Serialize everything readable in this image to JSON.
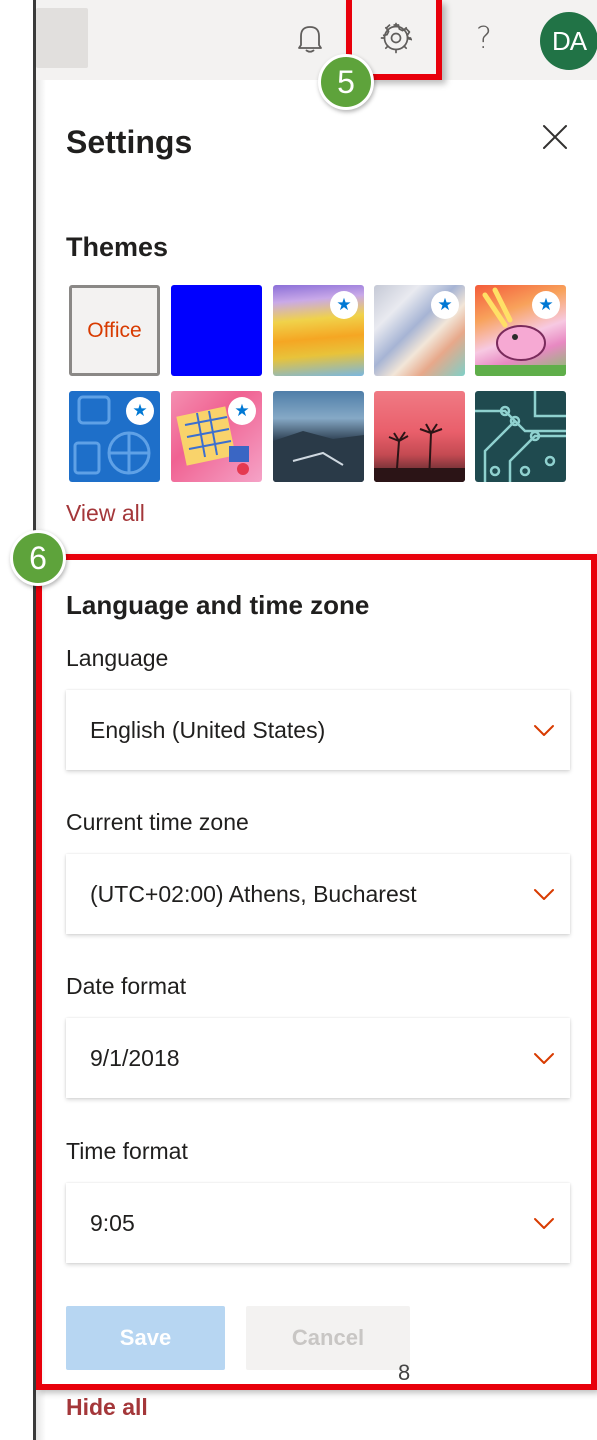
{
  "topbar": {
    "help_glyph": "?",
    "avatar_initials": "DA"
  },
  "callouts": {
    "step_5": "5",
    "step_6": "6"
  },
  "settings": {
    "title": "Settings"
  },
  "themes": {
    "title": "Themes",
    "office_label": "Office",
    "star_glyph": "★",
    "view_all": "View all"
  },
  "language_section": {
    "title": "Language and time zone",
    "language_label": "Language",
    "language_value": "English (United States)",
    "timezone_label": "Current time zone",
    "timezone_value": "(UTC+02:00) Athens, Bucharest",
    "date_format_label": "Date format",
    "date_format_value": "9/1/2018",
    "time_format_label": "Time format",
    "time_format_value": "9:05"
  },
  "actions": {
    "save": "Save",
    "cancel": "Cancel"
  },
  "page_number": "8",
  "footer": {
    "hide_all": "Hide all"
  },
  "colors": {
    "accent_red": "#e8000b",
    "badge_green": "#5ea33b",
    "avatar_green": "#217346",
    "link_red": "#a4373a",
    "chevron_orange": "#d83b01"
  }
}
